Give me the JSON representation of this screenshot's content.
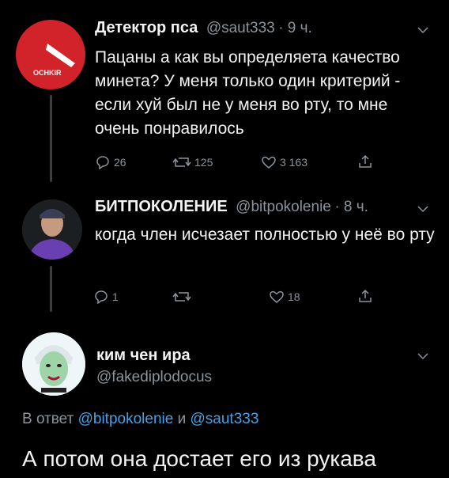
{
  "tweets": [
    {
      "name": "Детектор пса",
      "handle": "@saut333",
      "time": "· 9 ч.",
      "text": "Пацаны а как вы определяета качество минета? У меня только один критерий - если хуй был не у меня во рту, то мне очень понравилось",
      "avatar_text": "OCHKIR",
      "replies": "26",
      "retweets": "125",
      "likes": "3 163"
    },
    {
      "name": "БИТПОКОЛЕНИЕ",
      "handle": "@bitpokolenie",
      "time": "· 8 ч.",
      "text": "когда член исчезает полностью у неё во рту",
      "replies": "1",
      "retweets": "",
      "likes": "18"
    }
  ],
  "main_tweet": {
    "name": "ким чен ира",
    "handle": "@fakediplodocus",
    "reply_prefix": "В ответ",
    "reply_handle_1": "@bitpokolenie",
    "reply_joiner": "и",
    "reply_handle_2": "@saut333",
    "text": "А потом она достает его из рукава"
  },
  "icons": [
    "reply-icon",
    "retweet-icon",
    "like-icon",
    "share-icon",
    "chevron-down-icon"
  ],
  "colors": {
    "background": "#000000",
    "secondary": "#8a949c",
    "link": "#4aa0e6"
  }
}
